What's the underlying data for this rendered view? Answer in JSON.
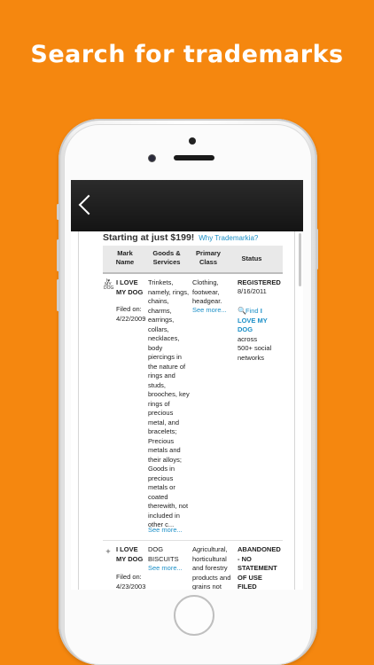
{
  "headline": "Search for trademarks",
  "promo": {
    "text": "Starting at just $199!",
    "link": "Why Trademarkia?"
  },
  "table": {
    "headers": {
      "mark": "Mark\nName",
      "goods": "Goods &\nServices",
      "class": "Primary\nClass",
      "status": "Status"
    },
    "rows": [
      {
        "mark_name": "I LOVE\nMY DOG",
        "filed": "Filed on:\n4/22/2009",
        "goods": "Trinkets,\nnamely, rings,\nchains,\ncharms,\nearrings,\ncollars,\nnecklaces,\nbody\npiercings in\nthe nature of\nrings and\nstuds,\nbrooches, key\nrings of\nprecious\nmetal, and\nbracelets;\nPrecious\nmetals and\ntheir alloys;\nGoods in\nprecious\nmetals or\ncoated\ntherewith, not\nincluded in\nother c...",
        "goods_more": "See more...",
        "class": "Clothing,\nfootwear,\nheadgear.",
        "class_more": "See more...",
        "status": "REGISTERED",
        "status_date": "8/16/2011",
        "find_prefix": "Find ",
        "find_link": "I\nLOVE MY\nDOG",
        "find_suffix": "across\n500+ social\nnetworks"
      },
      {
        "mark_name": "I LOVE\nMY DOG",
        "filed": "Filed on:\n4/23/2003",
        "goods": "DOG\nBISCUITS",
        "goods_more": "See more...",
        "class": "Agricultural,\nhorticultural\nand forestry\nproducts and\ngrains not",
        "status": "ABANDONED\n- NO\nSTATEMENT\nOF USE\nFILED"
      }
    ]
  }
}
